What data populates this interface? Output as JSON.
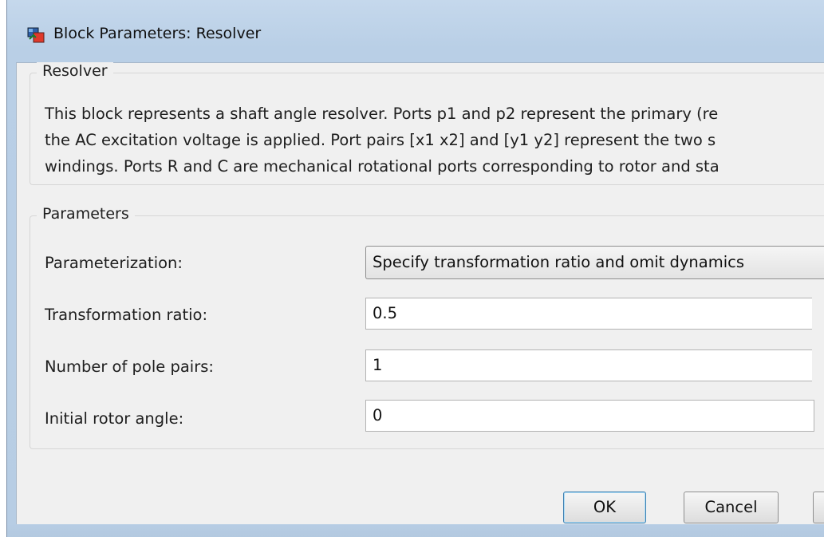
{
  "window": {
    "title": "Block Parameters: Resolver",
    "icon": "simulink-block-icon"
  },
  "description_group": {
    "legend": "Resolver",
    "lines": [
      "This block represents a shaft angle resolver. Ports p1 and p2 represent the primary (re",
      "the AC excitation voltage is applied. Port pairs [x1 x2] and [y1 y2] represent the two s",
      "windings. Ports R and C are mechanical rotational ports corresponding to rotor and sta"
    ]
  },
  "parameters_group": {
    "legend": "Parameters",
    "parameterization": {
      "label": "Parameterization:",
      "value": "Specify transformation ratio and omit dynamics"
    },
    "transformation_ratio": {
      "label": "Transformation ratio:",
      "value": "0.5"
    },
    "pole_pairs": {
      "label": "Number of pole pairs:",
      "value": "1"
    },
    "initial_rotor_angle": {
      "label": "Initial rotor angle:",
      "value": "0"
    }
  },
  "buttons": {
    "ok": "OK",
    "cancel": "Cancel"
  }
}
